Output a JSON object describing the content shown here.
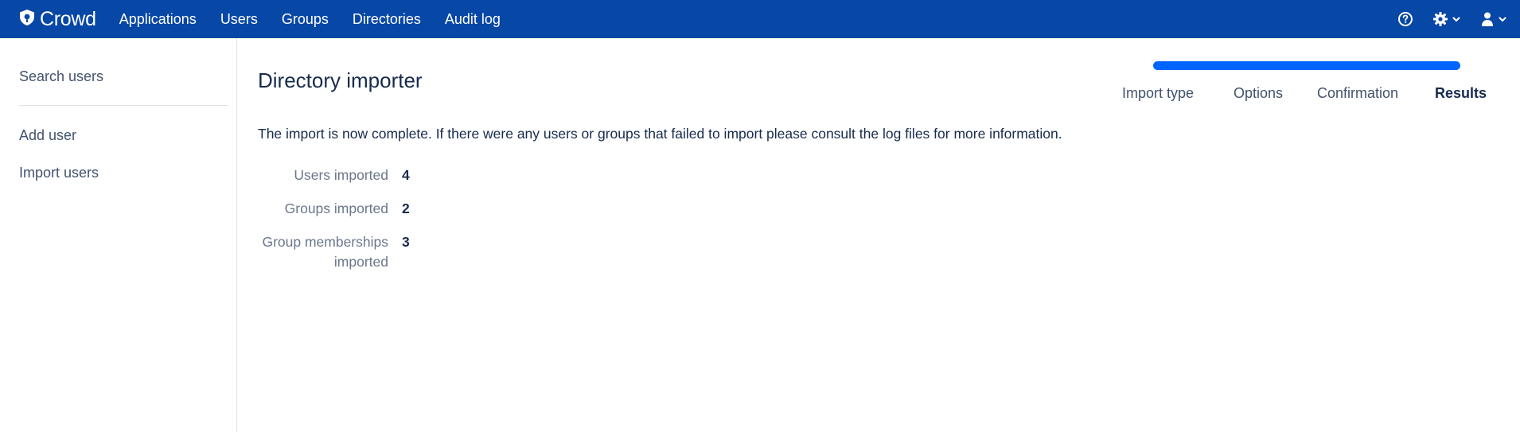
{
  "header": {
    "logo_text": "Crowd",
    "nav": [
      "Applications",
      "Users",
      "Groups",
      "Directories",
      "Audit log"
    ],
    "icons": [
      "help-icon",
      "settings-icon",
      "user-icon"
    ]
  },
  "sidebar": {
    "items": [
      "Search users",
      "Add user",
      "Import users"
    ]
  },
  "main": {
    "title": "Directory importer",
    "progress": {
      "steps": [
        "Import type",
        "Options",
        "Confirmation",
        "Results"
      ],
      "current": "Results",
      "fraction": 1.0
    },
    "message": "The import is now complete. If there were any users or groups that failed to import please consult the log files for more information.",
    "stats": [
      {
        "label": "Users imported",
        "value": "4"
      },
      {
        "label": "Groups imported",
        "value": "2"
      },
      {
        "label": "Group memberships imported",
        "value": "3"
      }
    ]
  },
  "colors": {
    "header_bg": "#0747a6",
    "progress": "#0065ff",
    "text": "#172b4d",
    "muted": "#6b778c"
  }
}
